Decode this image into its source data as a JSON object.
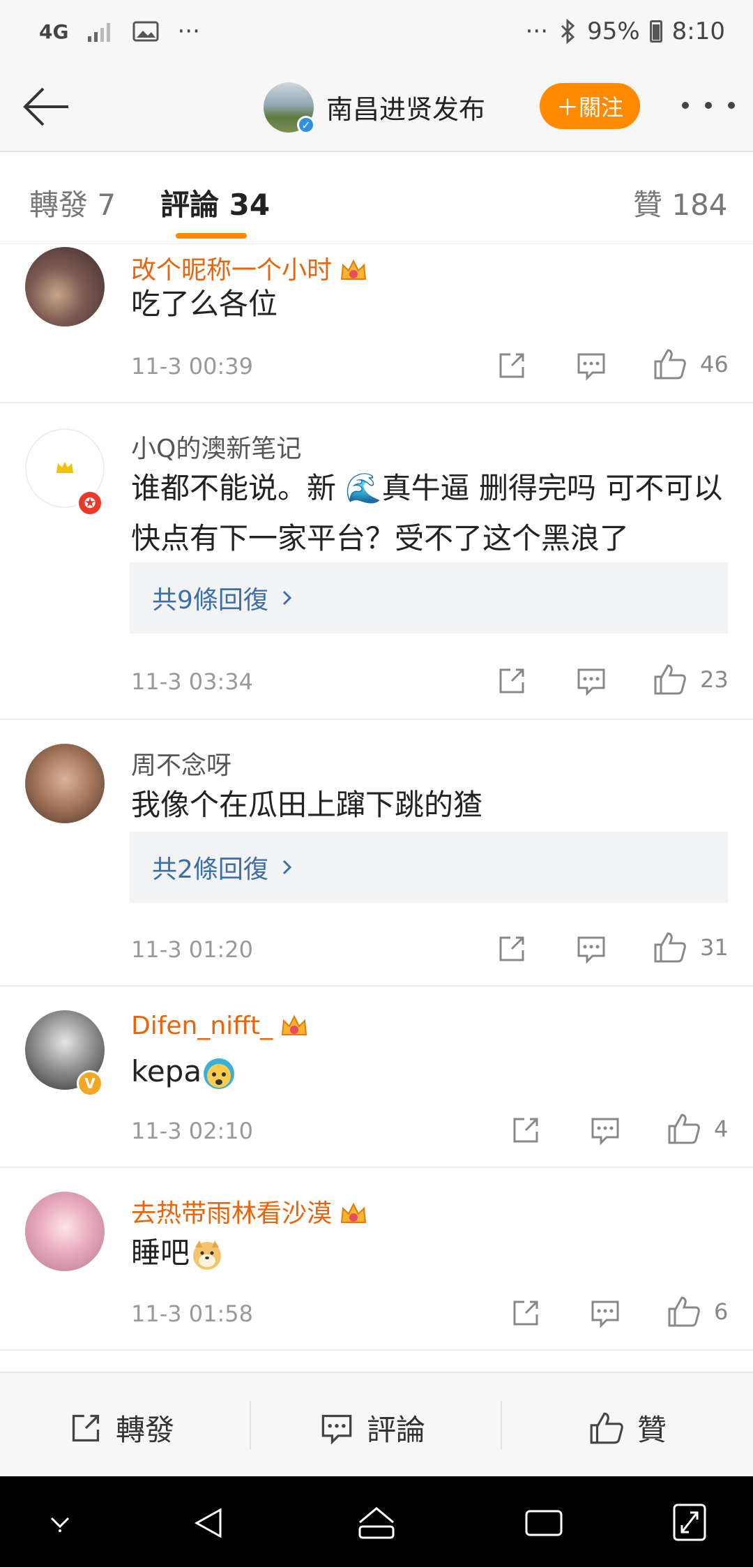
{
  "status_bar": {
    "network": "4G",
    "battery": "95%",
    "time": "8:10",
    "dots": "···"
  },
  "nav": {
    "title": "南昌进贤发布",
    "follow_label": "＋關注"
  },
  "tabs": [
    {
      "label": "轉發 7"
    },
    {
      "label": "評論 34"
    },
    {
      "label": "贊 184"
    }
  ],
  "comments": [
    {
      "name": "改个昵称一个小时",
      "text": "吃了么各位",
      "time": "11-3 00:39",
      "likes": "46"
    },
    {
      "name": "小Q的澳新笔记",
      "text": "谁都不能说。新 🌊真牛逼 删得完吗 可不可以快点有下一家平台？受不了这个黑浪了",
      "replies": "共9條回復",
      "time": "11-3 03:34",
      "likes": "23"
    },
    {
      "name": "周不念呀",
      "text": "我像个在瓜田上蹿下跳的猹",
      "replies": "共2條回復",
      "time": "11-3 01:20",
      "likes": "31"
    },
    {
      "name": "Difen_nifft_",
      "text": "kepa",
      "time": "11-3 02:10",
      "likes": "4"
    },
    {
      "name": "去热带雨林看沙漠",
      "text": "睡吧",
      "time": "11-3 01:58",
      "likes": "6"
    }
  ],
  "bottom_bar": {
    "repost": "轉發",
    "comment": "評論",
    "like": "贊"
  },
  "colors": {
    "accent": "#ff8a00",
    "vip_name": "#e8650c",
    "link": "#3d6ea8"
  }
}
